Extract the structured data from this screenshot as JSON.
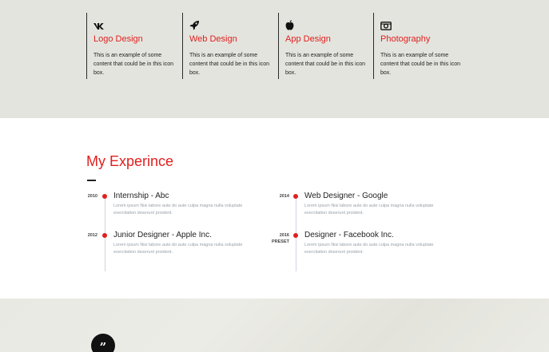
{
  "services": [
    {
      "icon": "vk-icon",
      "title": "Logo Design",
      "text": "This is an example of some content that could be in this icon box."
    },
    {
      "icon": "rocket-icon",
      "title": "Web Design",
      "text": "This is an example of some content that could be in this icon box."
    },
    {
      "icon": "apple-icon",
      "title": "App Design",
      "text": "This is an example of some content that could be in this icon box."
    },
    {
      "icon": "camera-icon",
      "title": "Photography",
      "text": "This is an example of some content that could be in this icon box."
    }
  ],
  "experience": {
    "title": "My Experince",
    "items": [
      {
        "year": "2010",
        "badge": "",
        "role": "Internship - Abc",
        "desc": "Lorem ipsum Nisi labore aute do aute culpa magna nulla voluptate exercitation deserunt proident."
      },
      {
        "year": "2012",
        "badge": "",
        "role": "Junior Designer - Apple Inc.",
        "desc": "Lorem ipsum Nisi labore aute do aute culpa magna nulla voluptate exercitation deserunt proident."
      },
      {
        "year": "2014",
        "badge": "",
        "role": "Web Designer - Google",
        "desc": "Lorem ipsum Nisi labore aute do aute culpa magna nulla voluptate exercitation deserunt proident."
      },
      {
        "year": "2016",
        "badge": "PRESET",
        "role": "Designer - Facebook Inc.",
        "desc": "Lorem ipsum Nisi labore aute do aute culpa magna nulla voluptate exercitation deserunt proident."
      }
    ]
  },
  "testimonial": {
    "quote_mark": "”",
    "quote_icon": "quote-icon"
  },
  "colors": {
    "accent": "#e0201f",
    "band": "#e4e4de",
    "text": "#222222",
    "muted": "#9aa0a6"
  }
}
